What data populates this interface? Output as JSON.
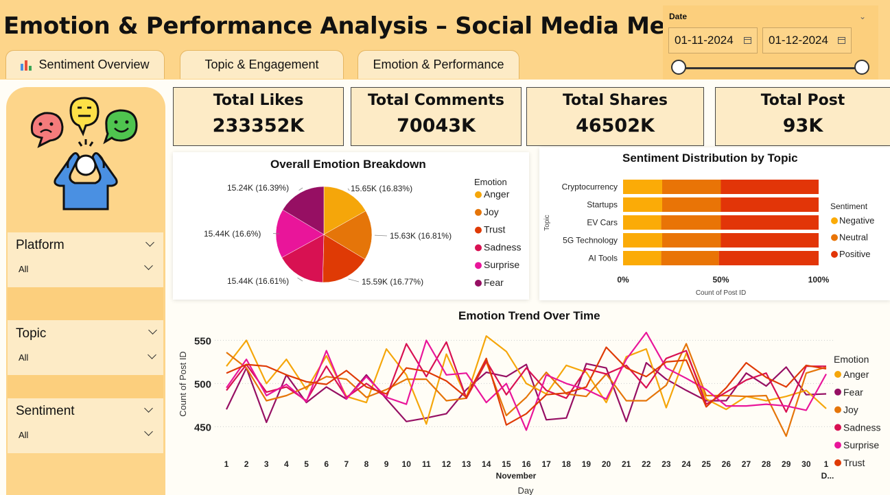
{
  "header": {
    "title": "Emotion & Performance Analysis – Social Media Metrics"
  },
  "tabs": [
    {
      "label": "Sentiment Overview",
      "icon": "bar-chart-icon"
    },
    {
      "label": "Topic & Engagement"
    },
    {
      "label": "Emotion & Performance"
    }
  ],
  "date_filter": {
    "label": "Date",
    "start": "01-11-2024",
    "end": "01-12-2024"
  },
  "sidebar": {
    "illustration": "stressed-person-emoji-icon",
    "filters": [
      {
        "label": "Platform",
        "value": "All"
      },
      {
        "label": "Topic",
        "value": "All"
      },
      {
        "label": "Sentiment",
        "value": "All"
      }
    ]
  },
  "kpis": [
    {
      "label": "Total Likes",
      "value": "233352K"
    },
    {
      "label": "Total Comments",
      "value": "70043K"
    },
    {
      "label": "Total Shares",
      "value": "46502K"
    },
    {
      "label": "Total Post",
      "value": "93K"
    }
  ],
  "colors": {
    "Anger": "#f5a60a",
    "Joy": "#e57509",
    "Trust": "#df3a05",
    "Sadness": "#d81152",
    "Surprise": "#e9159a",
    "Fear": "#960f63",
    "Negative": "#fbab07",
    "Neutral": "#e97406",
    "Positive": "#e23508"
  },
  "chart_data": [
    {
      "type": "pie",
      "title": "Overall Emotion Breakdown",
      "legend_title": "Emotion",
      "legend_position": "right",
      "slices": [
        {
          "name": "Anger",
          "label": "15.65K (16.83%)",
          "value": 15.65
        },
        {
          "name": "Joy",
          "label": "15.63K (16.81%)",
          "value": 15.63
        },
        {
          "name": "Trust",
          "label": "15.59K (16.77%)",
          "value": 15.59
        },
        {
          "name": "Sadness",
          "label": "15.44K (16.61%)",
          "value": 15.44
        },
        {
          "name": "Surprise",
          "label": "15.44K (16.6%)",
          "value": 15.44
        },
        {
          "name": "Fear",
          "label": "15.24K (16.39%)",
          "value": 15.24
        }
      ]
    },
    {
      "type": "bar",
      "orientation": "horizontal",
      "stacked": "100%",
      "title": "Sentiment Distribution by Topic",
      "xlabel": "Count of Post ID",
      "ylabel": "Topic",
      "legend_title": "Sentiment",
      "legend_position": "right",
      "x_ticks": [
        "0%",
        "50%",
        "100%"
      ],
      "categories": [
        "Cryptocurrency",
        "Startups",
        "EV Cars",
        "5G Technology",
        "AI Tools"
      ],
      "series": [
        {
          "name": "Negative",
          "values": [
            20,
            20,
            19.5,
            20,
            19.5
          ]
        },
        {
          "name": "Neutral",
          "values": [
            30,
            30,
            30.5,
            30,
            29.5
          ]
        },
        {
          "name": "Positive",
          "values": [
            50,
            50,
            50,
            50,
            51
          ]
        }
      ]
    },
    {
      "type": "line",
      "title": "Emotion Trend Over Time",
      "xlabel": "Day",
      "x_group_labels": [
        "November",
        "D..."
      ],
      "ylabel": "Count of Post ID",
      "ylim": [
        432,
        563
      ],
      "y_ticks": [
        450,
        500,
        550
      ],
      "grid": true,
      "legend_title": "Emotion",
      "legend_position": "right",
      "legend_order": [
        "Anger",
        "Fear",
        "Joy",
        "Sadness",
        "Surprise",
        "Trust"
      ],
      "x": [
        "1",
        "2",
        "3",
        "4",
        "5",
        "6",
        "7",
        "8",
        "9",
        "10",
        "11",
        "12",
        "13",
        "14",
        "15",
        "16",
        "17",
        "18",
        "19",
        "20",
        "21",
        "22",
        "23",
        "24",
        "25",
        "26",
        "27",
        "28",
        "29",
        "30",
        "1"
      ],
      "series": [
        {
          "name": "Anger",
          "values": [
            520,
            550,
            500,
            528,
            493,
            532,
            485,
            478,
            540,
            510,
            453,
            534,
            484,
            555,
            537,
            500,
            488,
            521,
            513,
            478,
            531,
            540,
            472,
            535,
            482,
            470,
            485,
            480,
            485,
            492,
            471
          ]
        },
        {
          "name": "Fear",
          "values": [
            470,
            518,
            455,
            510,
            478,
            496,
            482,
            510,
            482,
            456,
            460,
            465,
            493,
            513,
            508,
            522,
            458,
            460,
            523,
            518,
            456,
            524,
            505,
            492,
            480,
            480,
            512,
            497,
            519,
            487,
            488
          ]
        },
        {
          "name": "Joy",
          "values": [
            536,
            518,
            480,
            486,
            496,
            508,
            505,
            484,
            493,
            505,
            505,
            480,
            483,
            525,
            463,
            484,
            513,
            488,
            485,
            511,
            480,
            480,
            498,
            546,
            486,
            486,
            485,
            486,
            439,
            512,
            519
          ]
        },
        {
          "name": "Sadness",
          "values": [
            492,
            522,
            490,
            496,
            480,
            520,
            484,
            500,
            484,
            546,
            508,
            548,
            483,
            526,
            487,
            518,
            492,
            483,
            517,
            511,
            521,
            495,
            529,
            538,
            476,
            490,
            504,
            512,
            467,
            520,
            520
          ]
        },
        {
          "name": "Surprise",
          "values": [
            495,
            528,
            486,
            499,
            479,
            538,
            482,
            508,
            484,
            476,
            550,
            510,
            512,
            478,
            500,
            446,
            510,
            500,
            493,
            482,
            528,
            559,
            518,
            506,
            493,
            474,
            474,
            476,
            474,
            469,
            511
          ]
        },
        {
          "name": "Trust",
          "values": [
            512,
            522,
            520,
            510,
            502,
            499,
            515,
            496,
            488,
            518,
            514,
            503,
            484,
            529,
            452,
            465,
            487,
            489,
            496,
            542,
            518,
            508,
            525,
            527,
            473,
            495,
            524,
            507,
            496,
            521,
            517
          ]
        }
      ]
    }
  ]
}
